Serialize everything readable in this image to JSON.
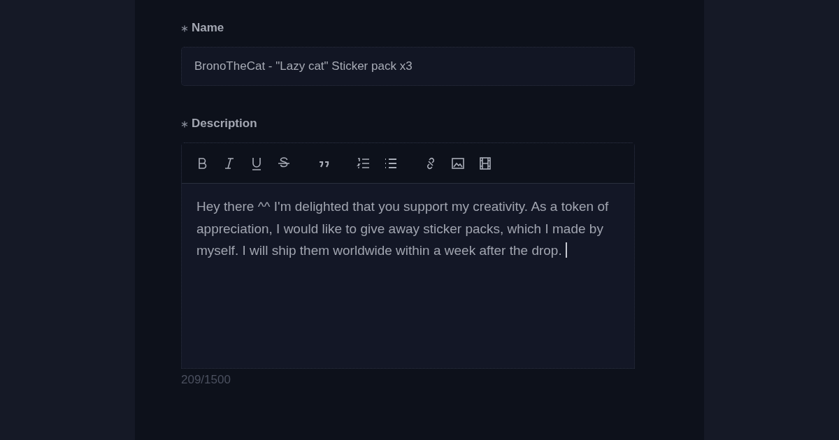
{
  "fields": [
    {
      "kind": "text",
      "label": "Name",
      "required": true,
      "value": "BronoTheCat - \"Lazy cat\" Sticker pack x3"
    },
    {
      "kind": "editor",
      "label": "Description",
      "required": true,
      "focused": true,
      "toolbar": [
        {
          "kind": "bold"
        },
        {
          "kind": "italic"
        },
        {
          "kind": "underline"
        },
        {
          "kind": "strike"
        },
        {
          "kind": "quote"
        },
        {
          "kind": "ordered-list"
        },
        {
          "kind": "bullet-list"
        },
        {
          "kind": "link"
        },
        {
          "kind": "image"
        },
        {
          "kind": "video"
        }
      ],
      "value": "Hey there ^^ I'm delighted that you support my creativity. As a token of appreciation, I would like to give away sticker packs, which I made by myself. I will ship them worldwide within a week after the drop.",
      "counter": "209/1500"
    }
  ]
}
